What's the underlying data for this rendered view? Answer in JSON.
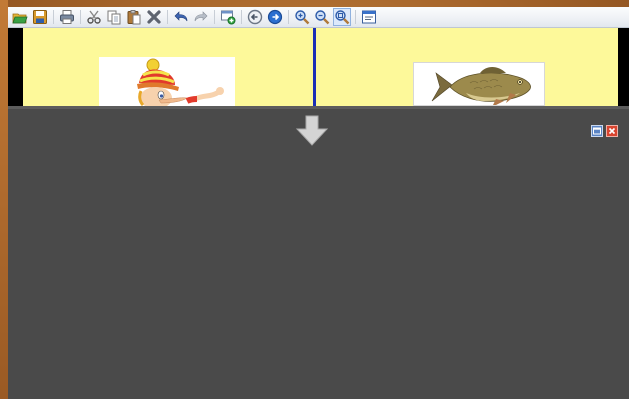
{
  "toolbar": {
    "buttons": [
      {
        "name": "open-button",
        "icon": "open-folder-icon"
      },
      {
        "name": "save-button",
        "icon": "floppy-disk-icon"
      },
      {
        "name": "print-button",
        "icon": "printer-icon"
      },
      {
        "name": "cut-button",
        "icon": "scissors-icon"
      },
      {
        "name": "copy-button",
        "icon": "copy-icon"
      },
      {
        "name": "paste-button",
        "icon": "clipboard-icon"
      },
      {
        "name": "delete-button",
        "icon": "x-mark-icon"
      },
      {
        "name": "undo-button",
        "icon": "undo-icon"
      },
      {
        "name": "redo-button",
        "icon": "redo-icon"
      },
      {
        "name": "add-page-button",
        "icon": "add-page-icon"
      },
      {
        "name": "previous-page-button",
        "icon": "arrow-left-circle-icon"
      },
      {
        "name": "next-page-button",
        "icon": "arrow-right-circle-icon"
      },
      {
        "name": "zoom-in-button",
        "icon": "zoom-in-icon"
      },
      {
        "name": "zoom-out-button",
        "icon": "zoom-out-icon"
      },
      {
        "name": "zoom-fit-button",
        "icon": "zoom-fit-icon"
      },
      {
        "name": "view-mode-button",
        "icon": "window-layout-icon"
      }
    ]
  },
  "canvas": {
    "left_image": "cartoon-boy-in-striped-hat",
    "right_image": "fish-photo"
  },
  "panel": {
    "arrow_icon": "down-arrow-icon",
    "controls": [
      "restore-icon",
      "close-icon"
    ]
  },
  "colors": {
    "page_background": "#fdf99a",
    "divider": "#1b2fb5",
    "panel_background": "#4a4a4a",
    "close_button": "#d9442f"
  }
}
